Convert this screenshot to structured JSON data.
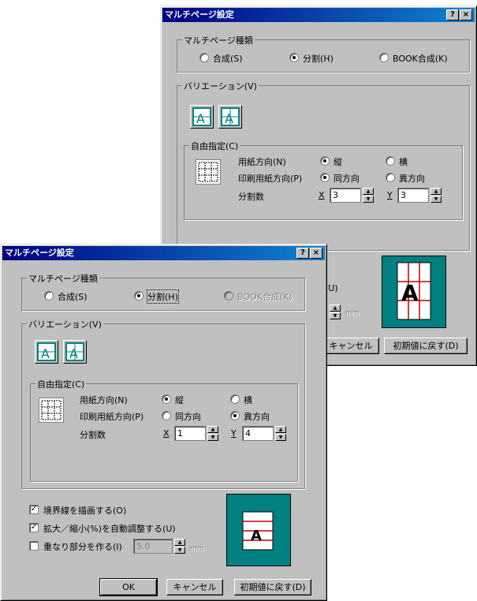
{
  "back": {
    "title": "マルチページ設定",
    "help": "?",
    "close": "×",
    "kind_group": "マルチページ種類",
    "kind_options": [
      "合成(S)",
      "分割(H)",
      "BOOK合成(K)"
    ],
    "variation_group": "バリエーション(V)",
    "free_group": "自由指定(C)",
    "paper_dir_label": "用紙方向(N)",
    "paper_dir_opts": [
      "縦",
      "横"
    ],
    "print_dir_label": "印刷用紙方向(P)",
    "print_dir_opts": [
      "同方向",
      "異方向"
    ],
    "split_label": "分割数",
    "x_label": "X",
    "y_label": "Y",
    "x_value": "3",
    "y_value": "3",
    "partial_u": "(U)",
    "mm": "mm",
    "cancel": "キャンセル",
    "reset": "初期値に戻す(D)"
  },
  "front": {
    "title": "マルチページ設定",
    "help": "?",
    "close": "×",
    "kind_group": "マルチページ種類",
    "kind_options": [
      "合成(S)",
      "分割(H)",
      "BOOK合成(K)"
    ],
    "variation_group": "バリエーション(V)",
    "free_group": "自由指定(C)",
    "paper_dir_label": "用紙方向(N)",
    "paper_dir_opts": [
      "縦",
      "横"
    ],
    "print_dir_label": "印刷用紙方向(P)",
    "print_dir_opts": [
      "同方向",
      "異方向"
    ],
    "split_label": "分割数",
    "x_label": "X",
    "y_label": "Y",
    "x_value": "1",
    "y_value": "4",
    "check_border": "境界線を描画する(O)",
    "check_scale": "拡大／縮小(%)を自動調整する(U)",
    "check_overlap": "重なり部分を作る(I)",
    "overlap_value": "5.0",
    "mm": "mm",
    "ok": "OK",
    "cancel": "キャンセル",
    "reset": "初期値に戻す(D)"
  }
}
